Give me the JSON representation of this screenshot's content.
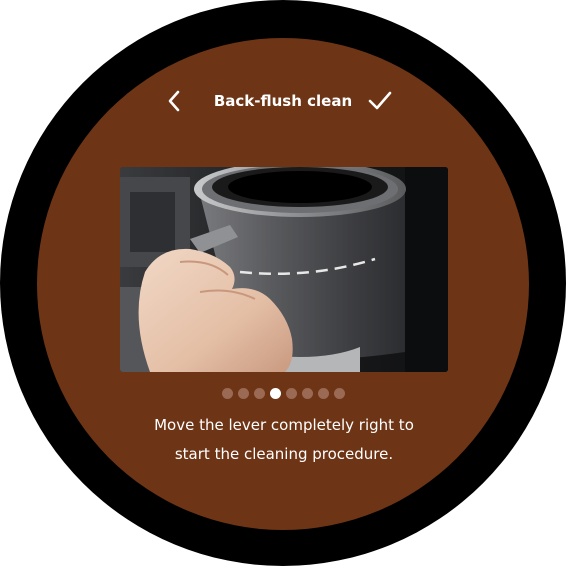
{
  "header": {
    "title": "Back-flush clean",
    "back_icon": "chevron-left-icon",
    "confirm_icon": "checkmark-icon"
  },
  "steps": {
    "total": 8,
    "current": 4
  },
  "instruction": {
    "text": "Move the lever completely right to start the cleaning procedure."
  },
  "colors": {
    "bezel": "#000000",
    "screen": "#6e3416",
    "dot_inactive": "#9a6a55",
    "dot_active": "#ffffff",
    "text": "#ffffff"
  }
}
